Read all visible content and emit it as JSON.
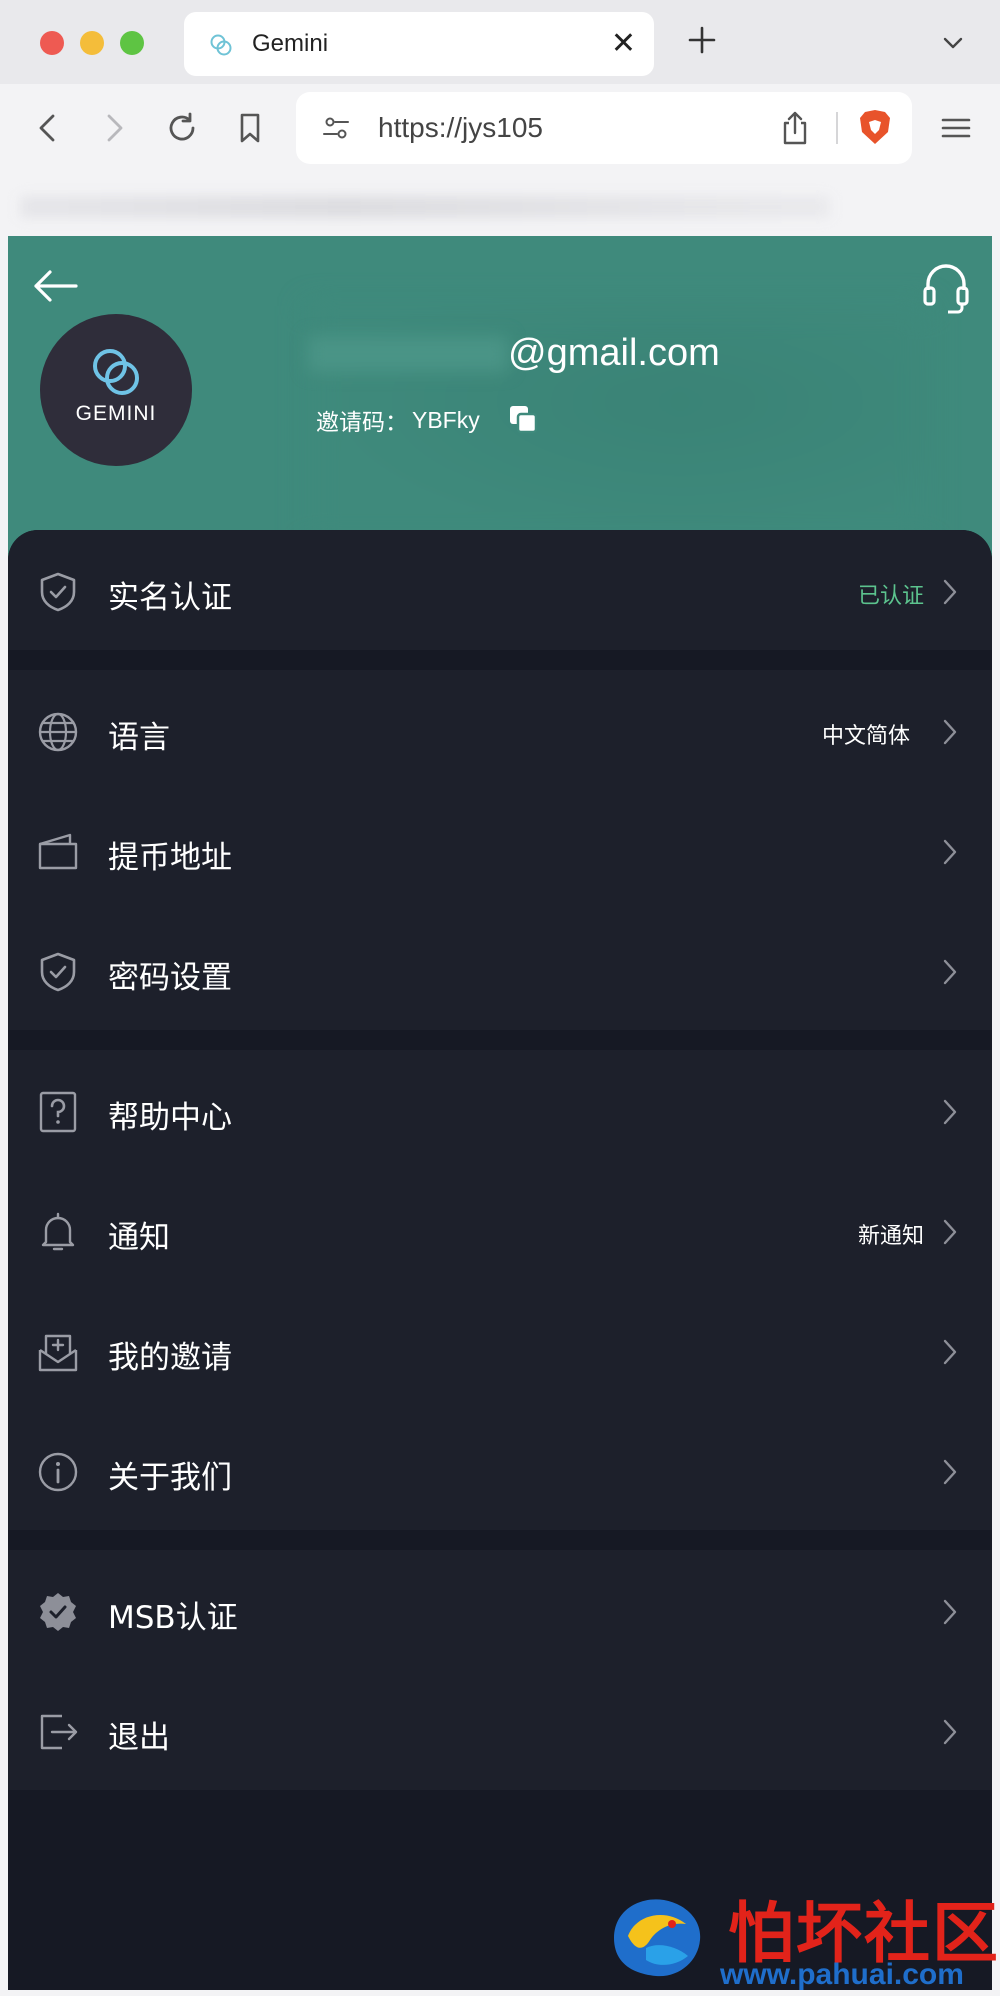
{
  "browser": {
    "tab_title": "Gemini",
    "tab_close": "✕",
    "url": "https://jys105"
  },
  "header": {
    "avatar_text": "GEMINI",
    "email": "@gmail.com",
    "invite_label": "邀请码：",
    "invite_code": "YBFky"
  },
  "menu": {
    "identity": {
      "label": "实名认证",
      "value": "已认证"
    },
    "language": {
      "label": "语言",
      "value": "中文简体"
    },
    "withdraw_address": {
      "label": "提币地址"
    },
    "password": {
      "label": "密码设置"
    },
    "help": {
      "label": "帮助中心"
    },
    "notifications": {
      "label": "通知",
      "value": "新通知"
    },
    "invitations": {
      "label": "我的邀请"
    },
    "about": {
      "label": "关于我们"
    },
    "msb": {
      "label": "MSB认证"
    },
    "logout": {
      "label": "退出"
    }
  },
  "watermark": {
    "title": "怕坏社区",
    "url": "www.pahuai.com"
  },
  "colors": {
    "header_bg": "#3f8a7c",
    "menu_bg": "#1d202b",
    "verified_green": "#5cc38e"
  }
}
